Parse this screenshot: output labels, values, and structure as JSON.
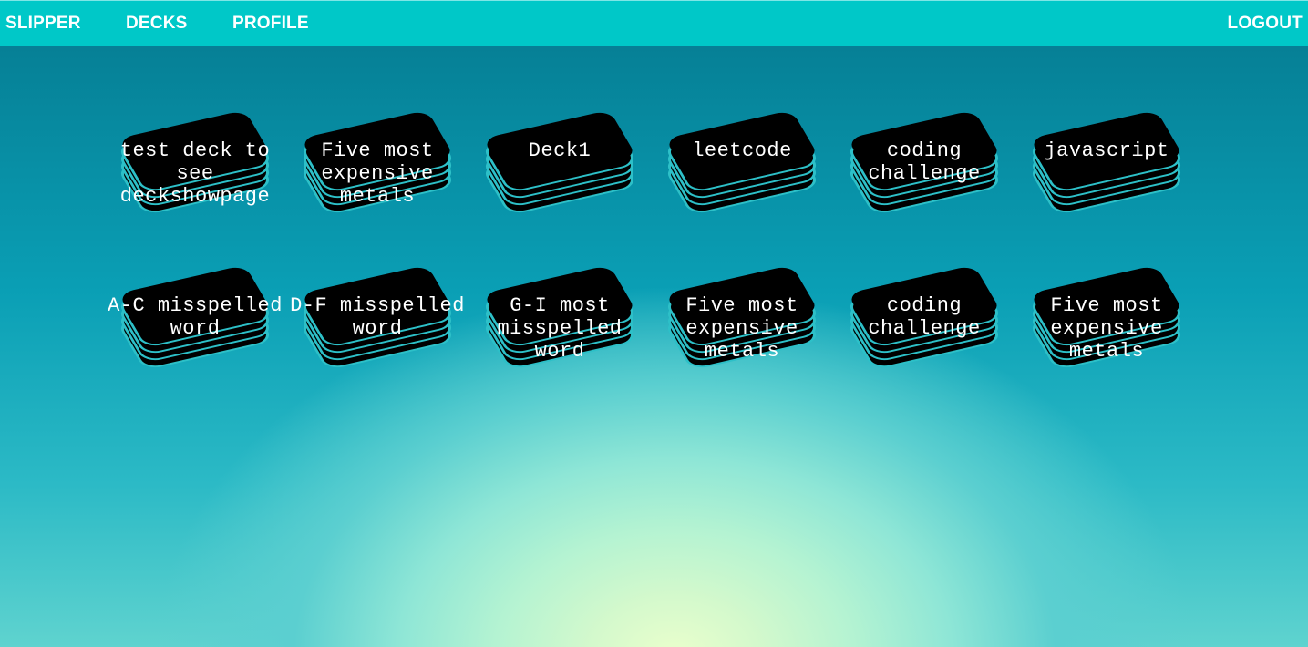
{
  "nav": {
    "brand": "SLIPPER",
    "decks": "DECKS",
    "profile": "PROFILE",
    "logout": "LOGOUT"
  },
  "colors": {
    "navbar": "#00c8c8",
    "card_face": "#000000",
    "card_edge": "#2dc0c8",
    "text": "#ffffff"
  },
  "decks": [
    {
      "title": "test deck to see deckshowpage"
    },
    {
      "title": "Five most expensive metals"
    },
    {
      "title": "Deck1"
    },
    {
      "title": "leetcode"
    },
    {
      "title": "coding challenge"
    },
    {
      "title": "javascript"
    },
    {
      "title": "A-C misspelled word"
    },
    {
      "title": "D-F misspelled word"
    },
    {
      "title": "G-I most misspelled word"
    },
    {
      "title": "Five most expensive metals"
    },
    {
      "title": "coding challenge"
    },
    {
      "title": "Five most expensive metals"
    }
  ]
}
